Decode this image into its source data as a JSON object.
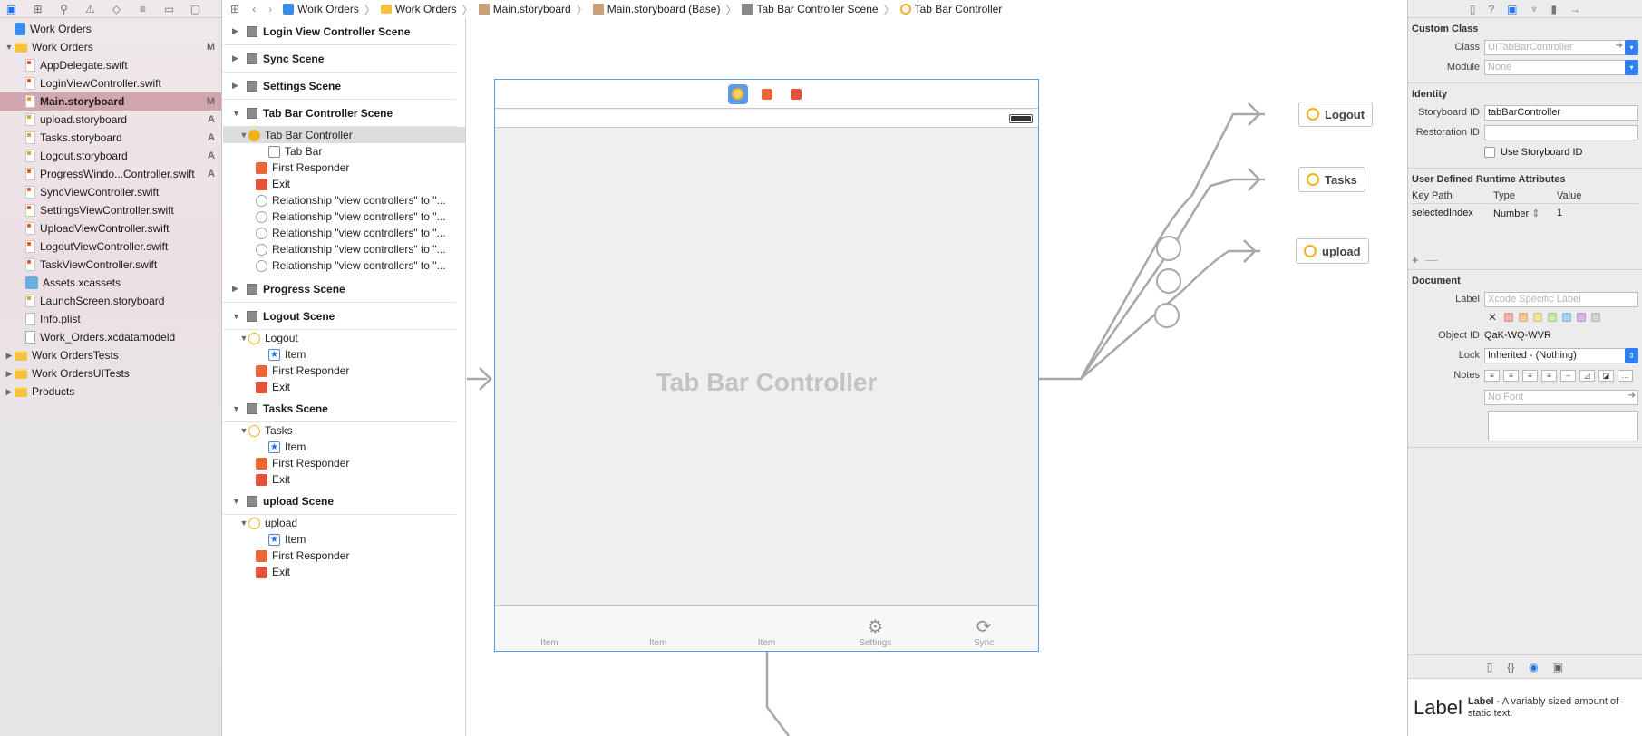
{
  "navigator": {
    "items": [
      {
        "label": "Work Orders",
        "icon": "project-icon",
        "indent": 0,
        "disc": "",
        "flag": "",
        "kind": "proj"
      },
      {
        "label": "Work Orders",
        "icon": "folder-icon",
        "indent": 0,
        "disc": "▼",
        "flag": "M",
        "kind": "folder"
      },
      {
        "label": "AppDelegate.swift",
        "icon": "swift-file-icon",
        "indent": 1,
        "disc": "",
        "flag": "",
        "kind": "swift"
      },
      {
        "label": "LoginViewController.swift",
        "icon": "swift-file-icon",
        "indent": 1,
        "disc": "",
        "flag": "",
        "kind": "swift"
      },
      {
        "label": "Main.storyboard",
        "icon": "storyboard-file-icon",
        "indent": 1,
        "disc": "",
        "flag": "M",
        "kind": "story",
        "selected": true
      },
      {
        "label": "upload.storyboard",
        "icon": "storyboard-file-icon",
        "indent": 1,
        "disc": "",
        "flag": "A",
        "kind": "story"
      },
      {
        "label": "Tasks.storyboard",
        "icon": "storyboard-file-icon",
        "indent": 1,
        "disc": "",
        "flag": "A",
        "kind": "story"
      },
      {
        "label": "Logout.storyboard",
        "icon": "storyboard-file-icon",
        "indent": 1,
        "disc": "",
        "flag": "A",
        "kind": "story"
      },
      {
        "label": "ProgressWindo...Controller.swift",
        "icon": "swift-file-icon",
        "indent": 1,
        "disc": "",
        "flag": "A",
        "kind": "swift"
      },
      {
        "label": "SyncViewController.swift",
        "icon": "swift-file-icon",
        "indent": 1,
        "disc": "",
        "flag": "",
        "kind": "swift"
      },
      {
        "label": "SettingsViewController.swift",
        "icon": "swift-file-icon",
        "indent": 1,
        "disc": "",
        "flag": "",
        "kind": "swift"
      },
      {
        "label": "UploadViewController.swift",
        "icon": "swift-file-icon",
        "indent": 1,
        "disc": "",
        "flag": "",
        "kind": "swift"
      },
      {
        "label": "LogoutViewController.swift",
        "icon": "swift-file-icon",
        "indent": 1,
        "disc": "",
        "flag": "",
        "kind": "swift"
      },
      {
        "label": "TaskViewController.swift",
        "icon": "swift-file-icon",
        "indent": 1,
        "disc": "",
        "flag": "",
        "kind": "swift"
      },
      {
        "label": "Assets.xcassets",
        "icon": "assets-icon",
        "indent": 1,
        "disc": "",
        "flag": "",
        "kind": "assets"
      },
      {
        "label": "LaunchScreen.storyboard",
        "icon": "storyboard-file-icon",
        "indent": 1,
        "disc": "",
        "flag": "",
        "kind": "story"
      },
      {
        "label": "Info.plist",
        "icon": "plist-file-icon",
        "indent": 1,
        "disc": "",
        "flag": "",
        "kind": "plist"
      },
      {
        "label": "Work_Orders.xcdatamodeld",
        "icon": "data-model-icon",
        "indent": 1,
        "disc": "",
        "flag": "",
        "kind": "model"
      },
      {
        "label": "Work OrdersTests",
        "icon": "folder-icon",
        "indent": 0,
        "disc": "▶",
        "flag": "",
        "kind": "folder"
      },
      {
        "label": "Work OrdersUITests",
        "icon": "folder-icon",
        "indent": 0,
        "disc": "▶",
        "flag": "",
        "kind": "folder"
      },
      {
        "label": "Products",
        "icon": "folder-icon",
        "indent": 0,
        "disc": "▶",
        "flag": "",
        "kind": "folder"
      }
    ]
  },
  "jumpbar": {
    "crumbs": [
      "Work Orders",
      "Work Orders",
      "Main.storyboard",
      "Main.storyboard (Base)",
      "Tab Bar Controller Scene",
      "Tab Bar Controller"
    ]
  },
  "outline": {
    "collapsed_scenes": [
      "Login View Controller Scene",
      "Sync Scene",
      "Settings Scene"
    ],
    "tab_scene": {
      "title": "Tab Bar Controller Scene",
      "controller": "Tab Bar Controller",
      "tab_bar": "Tab Bar",
      "first_responder": "First Responder",
      "exit": "Exit",
      "relationships": [
        "Relationship \"view controllers\" to \"...",
        "Relationship \"view controllers\" to \"...",
        "Relationship \"view controllers\" to \"...",
        "Relationship \"view controllers\" to \"...",
        "Relationship \"view controllers\" to \"..."
      ]
    },
    "progress_scene": "Progress Scene",
    "scenes": [
      {
        "title": "Logout Scene",
        "vc": "Logout",
        "item": "Item",
        "first_responder": "First Responder",
        "exit": "Exit"
      },
      {
        "title": "Tasks Scene",
        "vc": "Tasks",
        "item": "Item",
        "first_responder": "First Responder",
        "exit": "Exit"
      },
      {
        "title": "upload Scene",
        "vc": "upload",
        "item": "Item",
        "first_responder": "First Responder",
        "exit": "Exit"
      }
    ]
  },
  "canvas": {
    "device_title": "Tab Bar Controller",
    "tabbar_items": [
      {
        "label": "Item",
        "glyph": ""
      },
      {
        "label": "Item",
        "glyph": ""
      },
      {
        "label": "Item",
        "glyph": ""
      },
      {
        "label": "Settings",
        "glyph": "⚙"
      },
      {
        "label": "Sync",
        "glyph": "⟳"
      }
    ],
    "external_vcs": [
      "Logout",
      "Tasks",
      "upload"
    ]
  },
  "inspector": {
    "custom_class": {
      "header": "Custom Class",
      "class_label": "Class",
      "class_placeholder": "UITabBarController",
      "module_label": "Module",
      "module_placeholder": "None"
    },
    "identity": {
      "header": "Identity",
      "storyboard_id_label": "Storyboard ID",
      "storyboard_id_value": "tabBarController",
      "restoration_id_label": "Restoration ID",
      "restoration_id_value": "",
      "use_storyboard_id_label": "Use Storyboard ID"
    },
    "udra": {
      "header": "User Defined Runtime Attributes",
      "col_key": "Key Path",
      "col_type": "Type",
      "col_value": "Value",
      "rows": [
        {
          "key": "selectedIndex",
          "type": "Number",
          "value": "1"
        }
      ]
    },
    "document": {
      "header": "Document",
      "label_label": "Label",
      "label_placeholder": "Xcode Specific Label",
      "swatches": [
        "#f3b3ad",
        "#f5cd9a",
        "#f2e39a",
        "#cfe8a6",
        "#a9d4f2",
        "#d9b8ec",
        "#d4d4d4"
      ],
      "object_id_label": "Object ID",
      "object_id_value": "QaK-WQ-WVR",
      "lock_label": "Lock",
      "lock_value": "Inherited - (Nothing)",
      "notes_label": "Notes",
      "font_placeholder": "No Font"
    },
    "library": {
      "big": "Label",
      "name": "Label",
      "desc": " - A variably sized amount of static text."
    }
  }
}
